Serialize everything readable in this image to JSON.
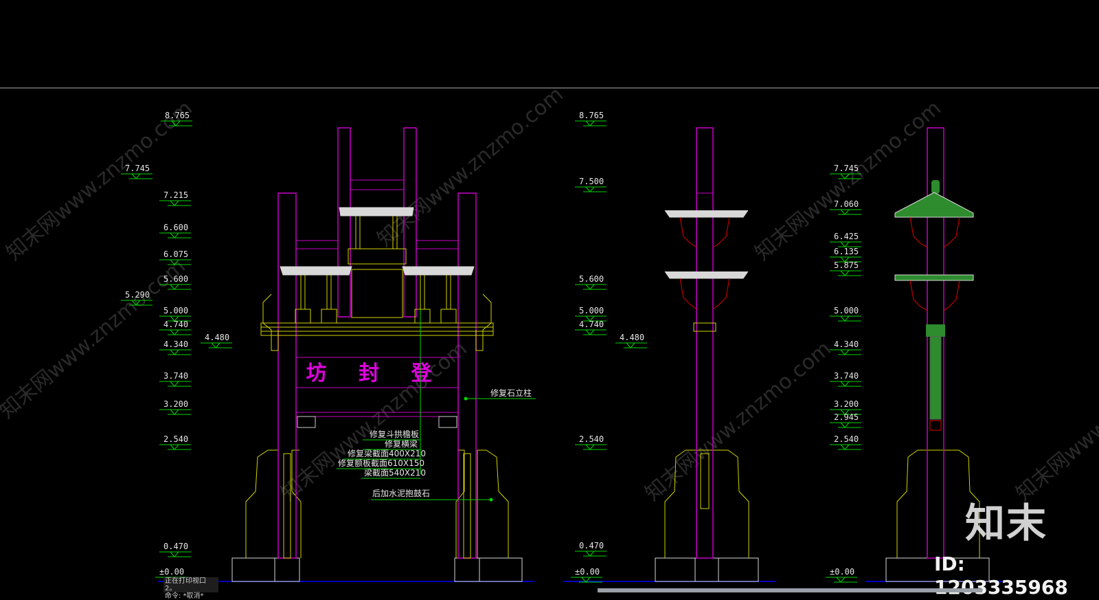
{
  "colors": {
    "background": "#000000",
    "pillar": "#c800c8",
    "stone": "#d4d400",
    "leader": "#00d800",
    "roof_fill": "#d8d8d8",
    "bracket": "#e00000",
    "text": "#e6e6e6",
    "ground": "#0000ff"
  },
  "levels_front_left": [
    "8.765",
    "7.745",
    "7.215",
    "6.600",
    "6.075",
    "5.600",
    "5.290",
    "5.000",
    "4.740",
    "4.340",
    "4.480",
    "3.740",
    "3.200",
    "2.540",
    "0.470",
    "±0.00"
  ],
  "levels_side": [
    "8.765",
    "7.500",
    "5.600",
    "5.000",
    "4.740",
    "4.480",
    "2.540",
    "0.470",
    "±0.00"
  ],
  "levels_section": [
    "7.745",
    "7.060",
    "6.425",
    "6.135",
    "5.875",
    "5.000",
    "4.340",
    "3.740",
    "3.200",
    "2.945",
    "2.540",
    "±0.00"
  ],
  "plaque_text": "坊  封  登",
  "annotations": {
    "pillar_repair": "修复石立柱",
    "bracket_board": "修复斗拱檐板",
    "beam_repair": "修复横梁",
    "beam_section": "修复梁截面400X210",
    "plate_section": "修复额板截面610X150",
    "beam_section2": "梁截面540X210",
    "drum_stone": "后加水泥抱鼓石"
  },
  "watermark": "知末网www.znzmo.com",
  "logo_text": "知末",
  "id_text": "ID: 1203335968",
  "command_lines": [
    "正在打印视口 2。",
    "命令: *取消*"
  ]
}
